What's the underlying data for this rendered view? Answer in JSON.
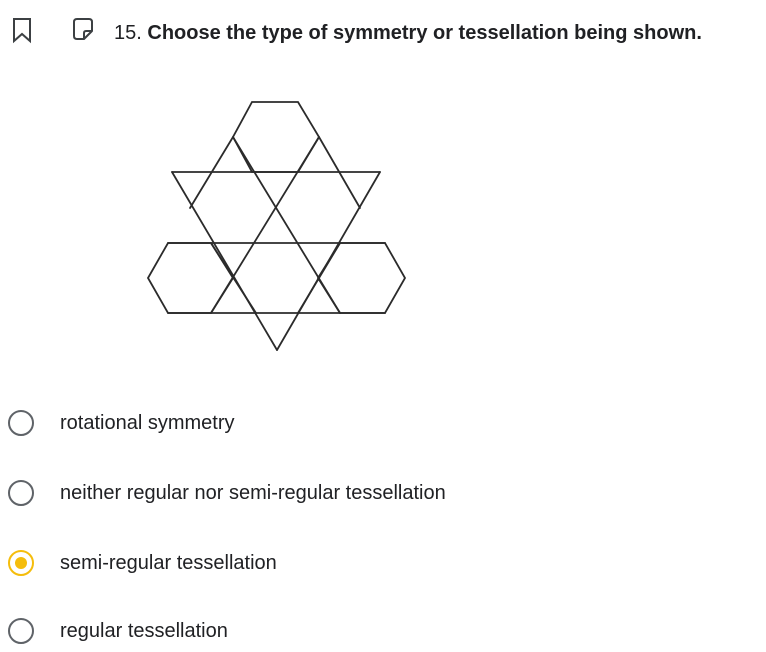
{
  "question": {
    "number": "15.",
    "text": "Choose the type of symmetry or tessellation being shown."
  },
  "options": [
    {
      "label": "rotational symmetry",
      "selected": false
    },
    {
      "label": "neither regular nor semi-regular tessellation",
      "selected": false
    },
    {
      "label": "semi-regular tessellation",
      "selected": true
    },
    {
      "label": "regular tessellation",
      "selected": false
    }
  ],
  "colors": {
    "accent": "#f5bd0c",
    "radio_border": "#5f6368",
    "text": "#202124",
    "figure_stroke": "#2b2b2b"
  }
}
